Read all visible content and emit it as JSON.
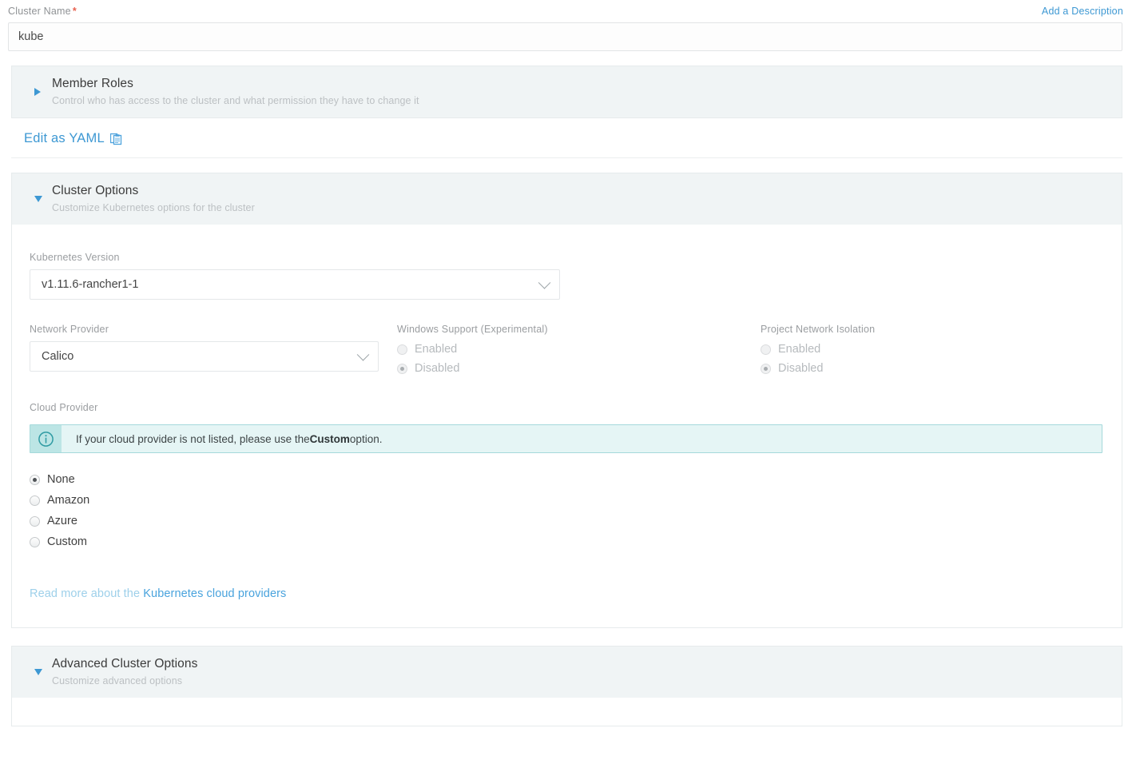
{
  "cluster_name": {
    "label": "Cluster Name",
    "required_mark": "*",
    "value": "kube",
    "add_description_link": "Add a Description"
  },
  "member_roles": {
    "title": "Member Roles",
    "subtitle": "Control who has access to the cluster and what permission they have to change it",
    "arrow": "caret-right-icon",
    "expanded": false
  },
  "yaml": {
    "label": "Edit as YAML",
    "icon": "clipboard-icon"
  },
  "cluster_options": {
    "title": "Cluster Options",
    "subtitle": "Customize Kubernetes options for the cluster",
    "arrow": "caret-down-icon",
    "expanded": true,
    "kubernetes_version": {
      "label": "Kubernetes Version",
      "value": "v1.11.6-rancher1-1"
    },
    "network_provider": {
      "label": "Network Provider",
      "value": "Calico"
    },
    "windows_support": {
      "label": "Windows Support (Experimental)",
      "disabled": true,
      "options": [
        {
          "label": "Enabled",
          "selected": false
        },
        {
          "label": "Disabled",
          "selected": true
        }
      ]
    },
    "project_network_isolation": {
      "label": "Project Network Isolation",
      "disabled": true,
      "options": [
        {
          "label": "Enabled",
          "selected": false
        },
        {
          "label": "Disabled",
          "selected": true
        }
      ]
    },
    "cloud_provider": {
      "label": "Cloud Provider",
      "banner": {
        "icon": "info-circle-icon",
        "text_before": "If your cloud provider is not listed, please use the ",
        "text_bold": "Custom",
        "text_after": " option."
      },
      "options": [
        {
          "label": "None",
          "selected": true
        },
        {
          "label": "Amazon",
          "selected": false
        },
        {
          "label": "Azure",
          "selected": false
        },
        {
          "label": "Custom",
          "selected": false
        }
      ],
      "read_more_prefix": "Read more about the ",
      "read_more_link": "Kubernetes cloud providers"
    }
  },
  "advanced_cluster_options": {
    "title": "Advanced Cluster Options",
    "subtitle": "Customize advanced options",
    "arrow": "caret-down-icon",
    "expanded": true
  },
  "colors": {
    "link": "#3d98d3",
    "required": "#e8614f",
    "banner_bg": "#e5f5f5",
    "banner_border": "#a5d9db",
    "header_bg": "#f0f4f5"
  }
}
